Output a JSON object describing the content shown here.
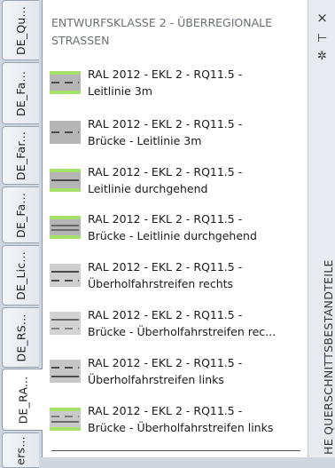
{
  "tabs": [
    {
      "label": "DE_Qu..."
    },
    {
      "label": "DE_Fa..."
    },
    {
      "label": "DE_Far..."
    },
    {
      "label": "DE_Fa..."
    },
    {
      "label": "DE_Lic..."
    },
    {
      "label": "DE_RS..."
    },
    {
      "label": "DE_RA...",
      "active": true
    },
    {
      "label": "ers..."
    }
  ],
  "group_title": "ENTWURFSKLASSE 2 - ÜBERREGIONALE STRASSEN",
  "items": [
    {
      "line1": "RAL 2012 - EKL 2 - RQ11.5 -",
      "line2": "Leitlinie 3m",
      "icon": "dashed-lane-icon"
    },
    {
      "line1": "RAL 2012 - EKL 2 - RQ11.5 -",
      "line2": "Brücke - Leitlinie 3m",
      "icon": "bridge-dashed-lane-icon"
    },
    {
      "line1": "RAL 2012 - EKL 2 - RQ11.5 -",
      "line2": "Leitlinie durchgehend",
      "icon": "solid-lane-icon"
    },
    {
      "line1": "RAL 2012 - EKL 2 - RQ11.5 -",
      "line2": "Brücke - Leitlinie durchgehend",
      "icon": "bridge-solid-lane-icon"
    },
    {
      "line1": "RAL 2012 - EKL 2 - RQ11.5 -",
      "line2": "Überholfahrstreifen rechts",
      "icon": "overtaking-right-icon"
    },
    {
      "line1": "RAL 2012 - EKL 2 - RQ11.5 -",
      "line2": "Brücke - Überholfahrstreifen rec...",
      "icon": "bridge-overtaking-right-icon"
    },
    {
      "line1": "RAL 2012 - EKL 2 - RQ11.5 -",
      "line2": "Überholfahrstreifen links",
      "icon": "overtaking-left-icon"
    },
    {
      "line1": "RAL 2012 - EKL 2 - RQ11.5 -",
      "line2": "Brücke - Überholfahrstreifen links",
      "icon": "bridge-overtaking-left-icon"
    }
  ],
  "titlebar": {
    "close_icon": "×",
    "pin_icon": "⊢",
    "settings_icon": "✲",
    "palette_title": "HE QUERSCHNITTSBESTANDTEILE"
  },
  "colors": {
    "green": "#a6e26a",
    "road_gray": "#b5b5b5",
    "line_dark": "#4a4a4a"
  }
}
